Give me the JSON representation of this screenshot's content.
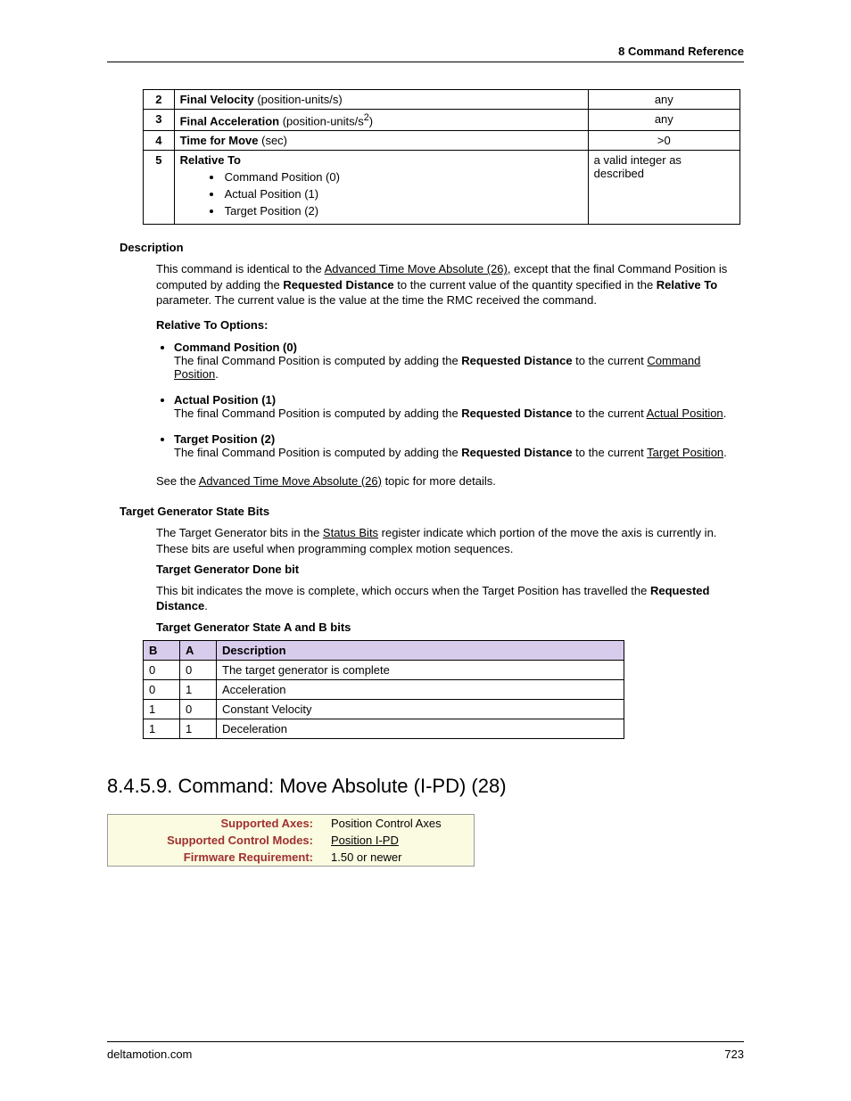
{
  "header": "8  Command Reference",
  "paramRows": [
    {
      "n": "2",
      "label": "Final Velocity",
      "units": " (position-units/s)",
      "range": "any",
      "rangeAlign": "center"
    },
    {
      "n": "3",
      "label": "Final Acceleration",
      "units": " (position-units/s",
      "sup": "2",
      "unitsAfter": ")",
      "range": "any",
      "rangeAlign": "center"
    },
    {
      "n": "4",
      "label": "Time for Move",
      "units": " (sec)",
      "range": ">0",
      "rangeAlign": "center"
    }
  ],
  "relRow": {
    "n": "5",
    "label": "Relative To",
    "items": [
      "Command Position (0)",
      "Actual Position (1)",
      "Target Position (2)"
    ],
    "range": "a valid integer as described"
  },
  "descHeading": "Description",
  "descPara": {
    "t1": "This command is identical to the ",
    "link1": "Advanced Time Move Absolute (26)",
    "t2": ", except that the final Command Position is computed by adding the ",
    "b1": "Requested Distance",
    "t3": " to the current value of the quantity specified in the ",
    "b2": "Relative To",
    "t4": " parameter. The current value is the value at the time the RMC received the command."
  },
  "relOptHeading": "Relative To Options:",
  "relOptions": [
    {
      "title": "Command Position (0)",
      "pre": "The final Command Position is computed by adding the ",
      "bold": "Requested Distance",
      "mid": " to the current ",
      "link": "Command Position",
      "post": "."
    },
    {
      "title": "Actual Position (1)",
      "pre": "The final Command Position is computed by adding the ",
      "bold": "Requested Distance",
      "mid": " to the current ",
      "link": "Actual Position",
      "post": "."
    },
    {
      "title": "Target Position (2)",
      "pre": "The final Command Position is computed by adding the ",
      "bold": "Requested Distance",
      "mid": " to the current ",
      "link": "Target Position",
      "post": "."
    }
  ],
  "seeMore": {
    "pre": "See the ",
    "link": "Advanced Time Move Absolute (26)",
    "post": " topic for more details."
  },
  "tgHeading": "Target Generator State Bits",
  "tgPara": {
    "t1": "The Target Generator bits in the ",
    "link": "Status Bits",
    "t2": " register indicate which portion of the move the axis is currently in. These bits are useful when programming complex motion sequences."
  },
  "tgDoneH": "Target Generator Done bit",
  "tgDonePara": {
    "t1": "This bit indicates the move is complete, which occurs when the Target Position has travelled the ",
    "b": "Requested Distance",
    "t2": "."
  },
  "tgABH": "Target Generator State A and B bits",
  "stateHeader": {
    "b": "B",
    "a": "A",
    "d": "Description"
  },
  "stateRows": [
    {
      "b": "0",
      "a": "0",
      "d": "The target generator is complete"
    },
    {
      "b": "0",
      "a": "1",
      "d": "Acceleration"
    },
    {
      "b": "1",
      "a": "0",
      "d": "Constant Velocity"
    },
    {
      "b": "1",
      "a": "1",
      "d": "Deceleration"
    }
  ],
  "cmdHeading": "8.4.5.9. Command: Move Absolute (I-PD) (28)",
  "supBox": {
    "r1l": "Supported Axes:",
    "r1v": "Position Control Axes",
    "r2l": "Supported Control Modes:",
    "r2v": "Position I-PD",
    "r3l": "Firmware Requirement:",
    "r3v": "1.50 or newer"
  },
  "footer": {
    "site": "deltamotion.com",
    "page": "723"
  }
}
